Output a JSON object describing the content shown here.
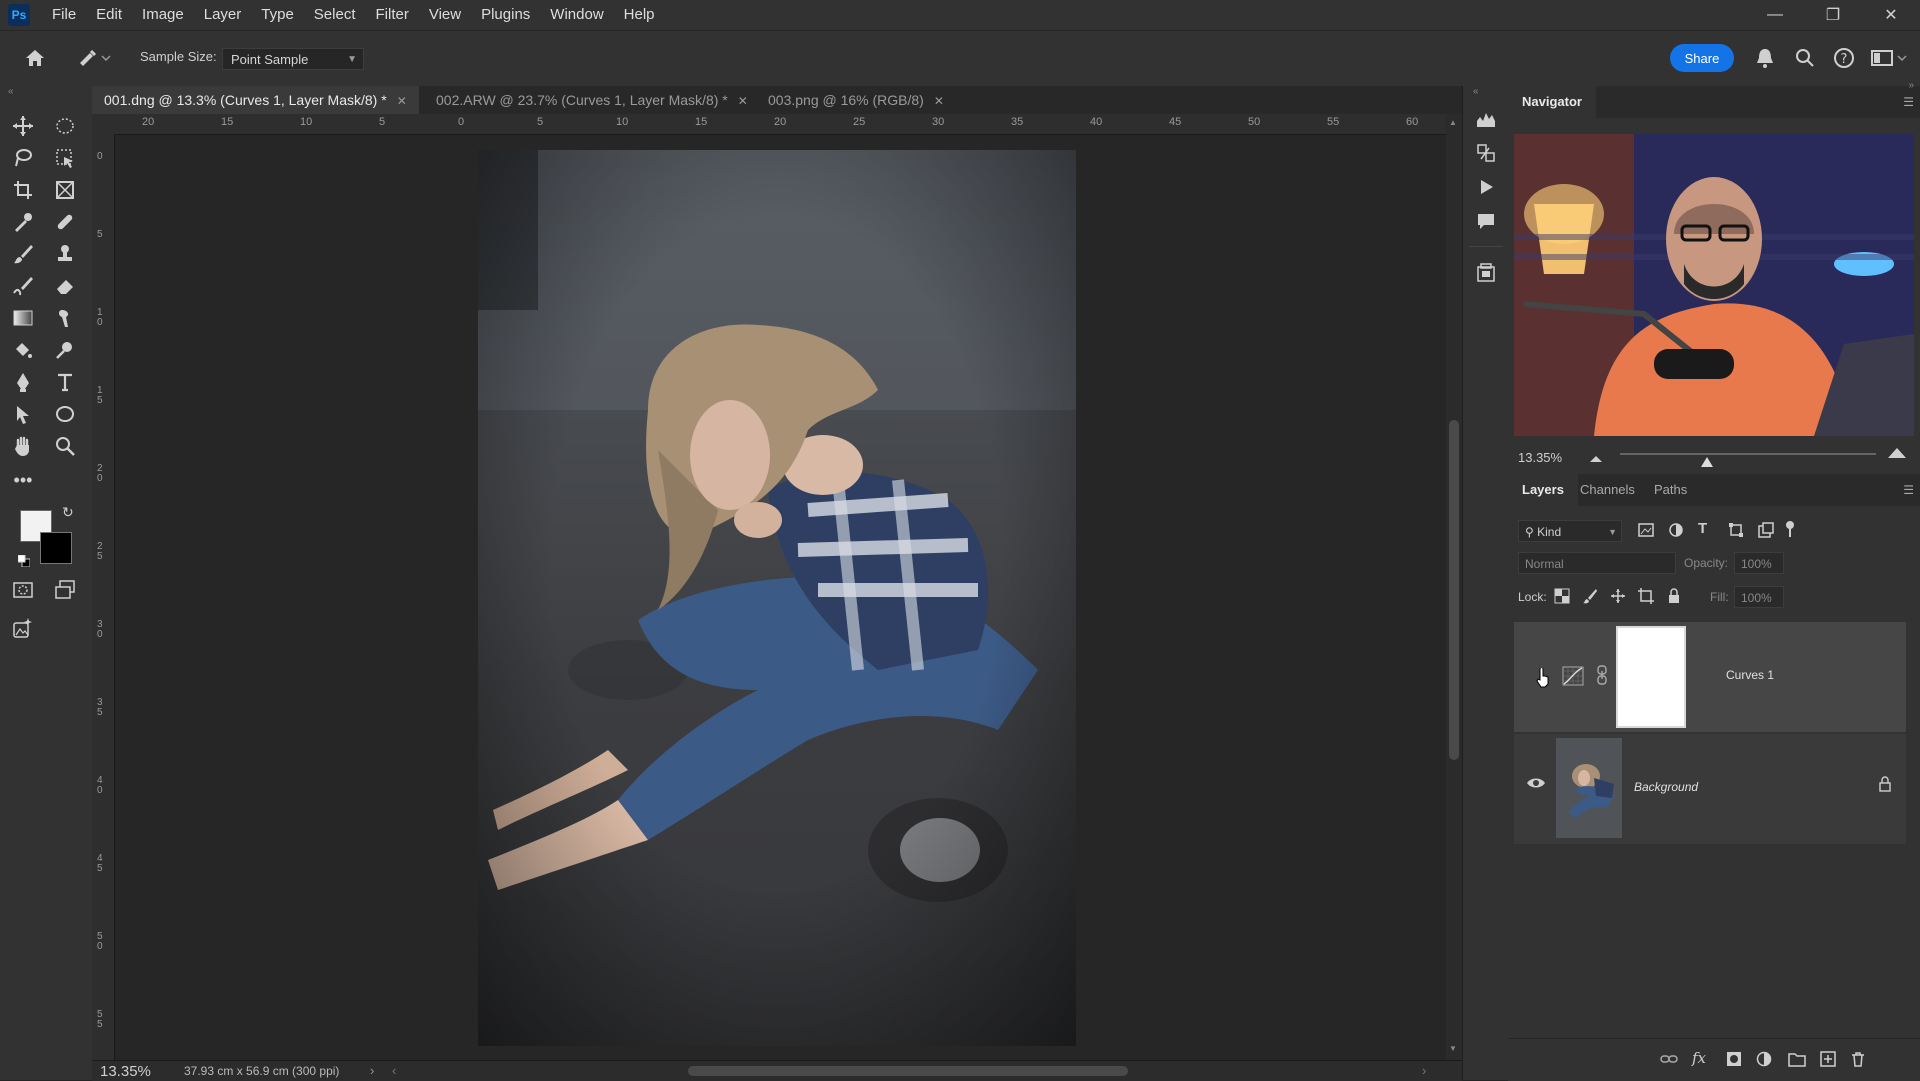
{
  "app": {
    "logo_text": "Ps",
    "menu": [
      "File",
      "Edit",
      "Image",
      "Layer",
      "Type",
      "Select",
      "Filter",
      "View",
      "Plugins",
      "Window",
      "Help"
    ]
  },
  "options": {
    "sample_size_label": "Sample Size:",
    "sample_size_value": "Point Sample",
    "share_label": "Share"
  },
  "tabs": [
    {
      "label": "001.dng @ 13.3% (Curves 1, Layer Mask/8) *"
    },
    {
      "label": "002.ARW @ 23.7% (Curves 1, Layer Mask/8) *"
    },
    {
      "label": "003.png @ 16% (RGB/8)"
    }
  ],
  "ruler_top": [
    "20",
    "15",
    "10",
    "5",
    "0",
    "5",
    "10",
    "15",
    "20",
    "25",
    "30",
    "35",
    "40",
    "45",
    "50",
    "55",
    "60"
  ],
  "ruler_left": [
    "0",
    "5",
    "1\n0",
    "1\n5",
    "2\n0",
    "2\n5",
    "3\n0",
    "3\n5",
    "4\n0",
    "4\n5",
    "5\n0",
    "5\n5"
  ],
  "status": {
    "zoom": "13.35%",
    "doc_size": "37.93 cm x 56.9 cm (300 ppi)"
  },
  "navigator": {
    "title": "Navigator",
    "zoom": "13.35%"
  },
  "layers_panel": {
    "tabs": [
      "Layers",
      "Channels",
      "Paths"
    ],
    "filter_kind": "Kind",
    "blend_mode": "Normal",
    "opacity_label": "Opacity:",
    "opacity_value": "100%",
    "lock_label": "Lock:",
    "fill_label": "Fill:",
    "fill_value": "100%",
    "layers": [
      {
        "name": "Curves 1"
      },
      {
        "name": "Background"
      }
    ]
  },
  "colors": {
    "accent": "#1473e6",
    "panel_bg": "#323232",
    "canvas_bg": "#262626"
  }
}
